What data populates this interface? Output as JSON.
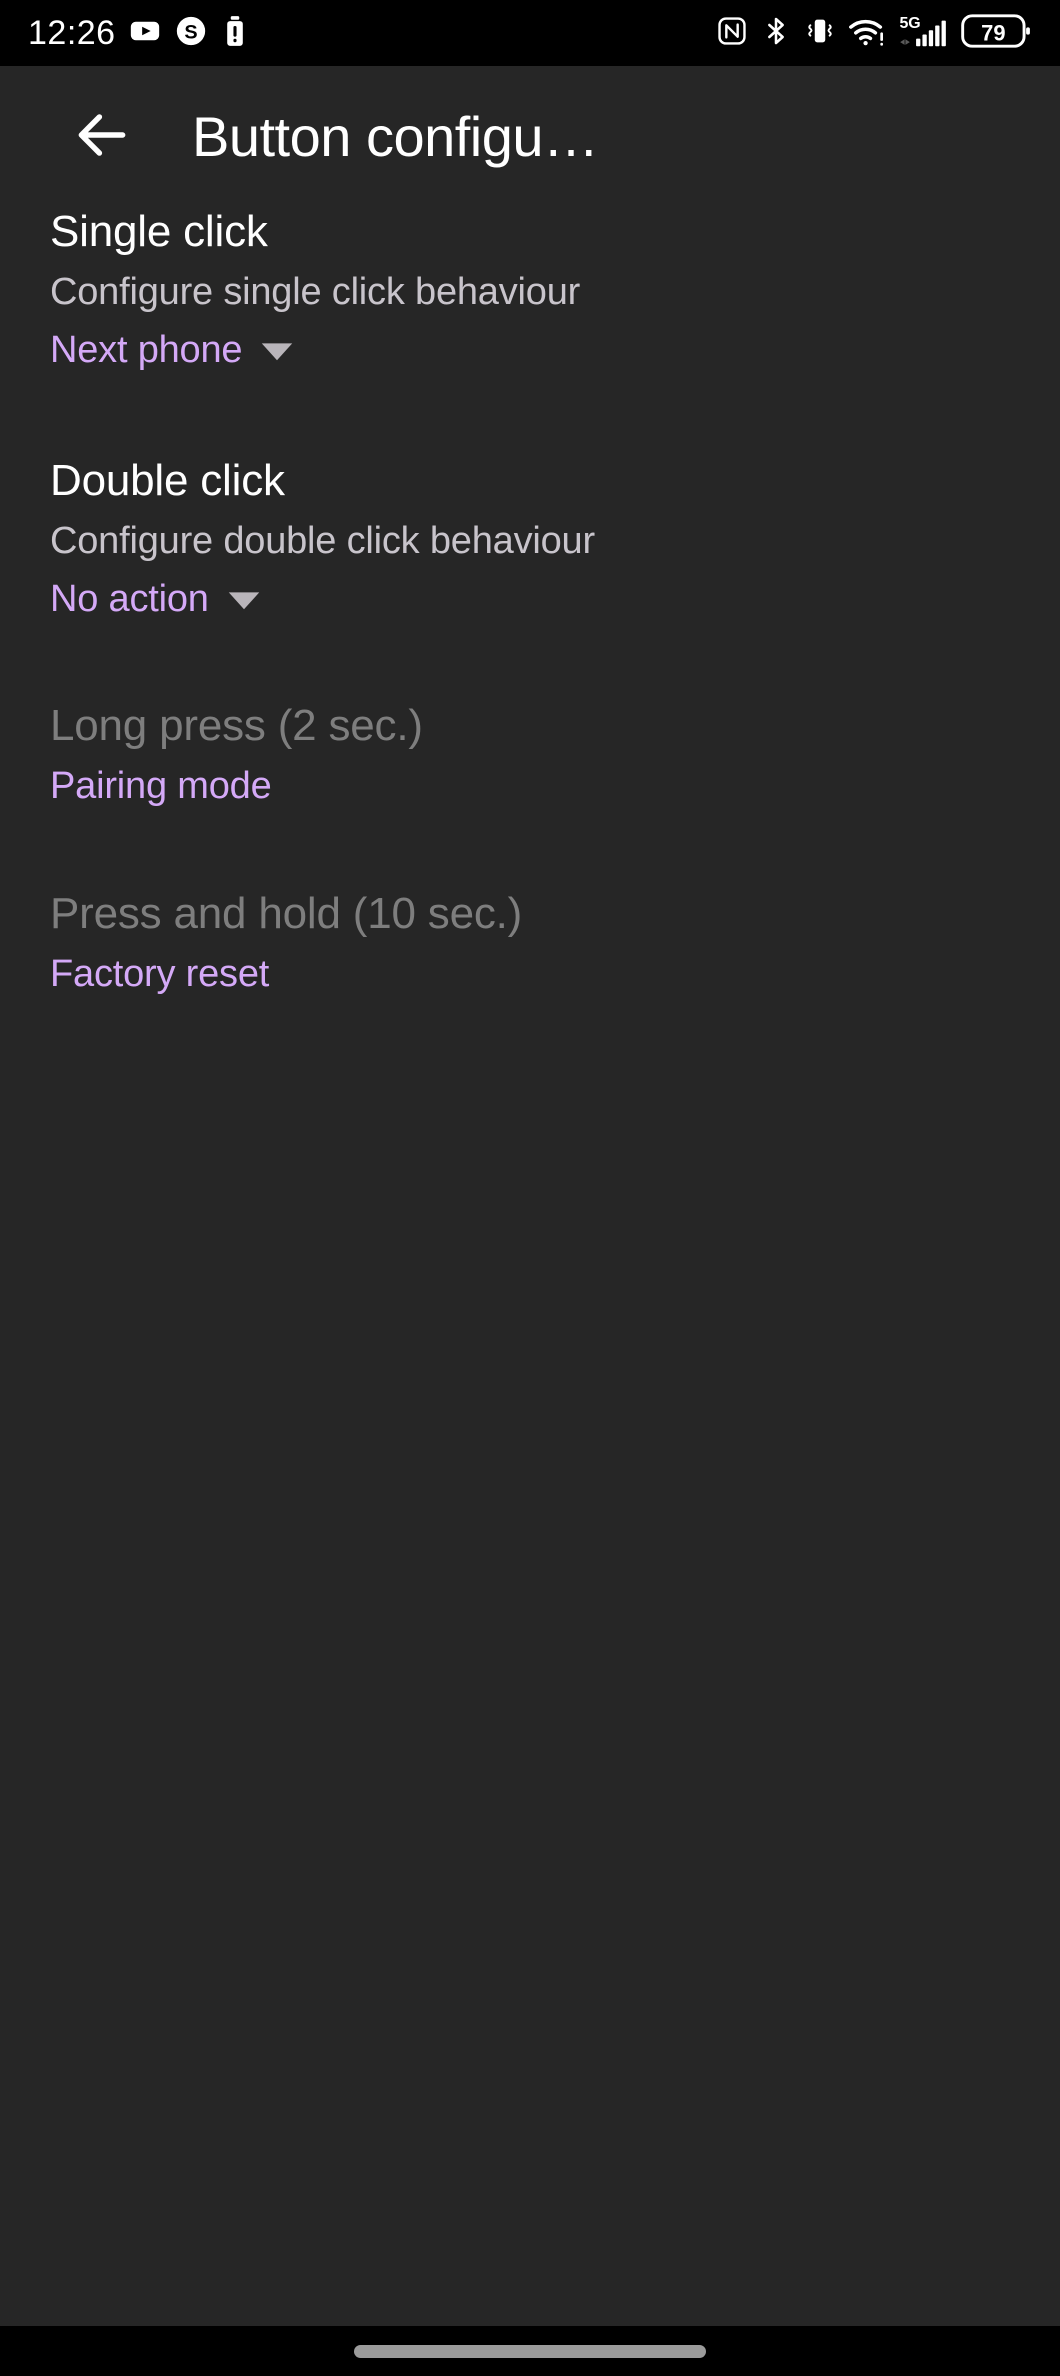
{
  "status_bar": {
    "clock": "12:26",
    "left_icons": [
      "youtube-icon",
      "skype-icon",
      "battery-alert-icon"
    ],
    "right_icons": [
      "nfc-icon",
      "bluetooth-icon",
      "vibrate-icon",
      "wifi-icon",
      "5g-signal-icon",
      "battery-icon"
    ],
    "network_label": "5G",
    "battery_level": "79"
  },
  "app_bar": {
    "back_label": "back-arrow",
    "title": "Button configu…"
  },
  "colors": {
    "background": "#262626",
    "status_bar_bg": "#000000",
    "accent_purple": "#d4a9f7",
    "primary_text": "#ffffff",
    "secondary_text": "#c8c4cb",
    "disabled_text": "#7e7e7e",
    "caret": "#b9b5ba",
    "nav_pill": "#9b9b9b"
  },
  "preferences": [
    {
      "title": "Single click",
      "summary": "Configure single click behaviour",
      "value": "Next phone",
      "has_dropdown": true,
      "enabled": true
    },
    {
      "title": "Double click",
      "summary": "Configure double click behaviour",
      "value": "No action",
      "has_dropdown": true,
      "enabled": true
    },
    {
      "title": "Long press (2 sec.)",
      "summary": "",
      "value": "Pairing mode",
      "has_dropdown": false,
      "enabled": false
    },
    {
      "title": "Press and hold (10 sec.)",
      "summary": "",
      "value": "Factory reset",
      "has_dropdown": false,
      "enabled": false
    }
  ]
}
